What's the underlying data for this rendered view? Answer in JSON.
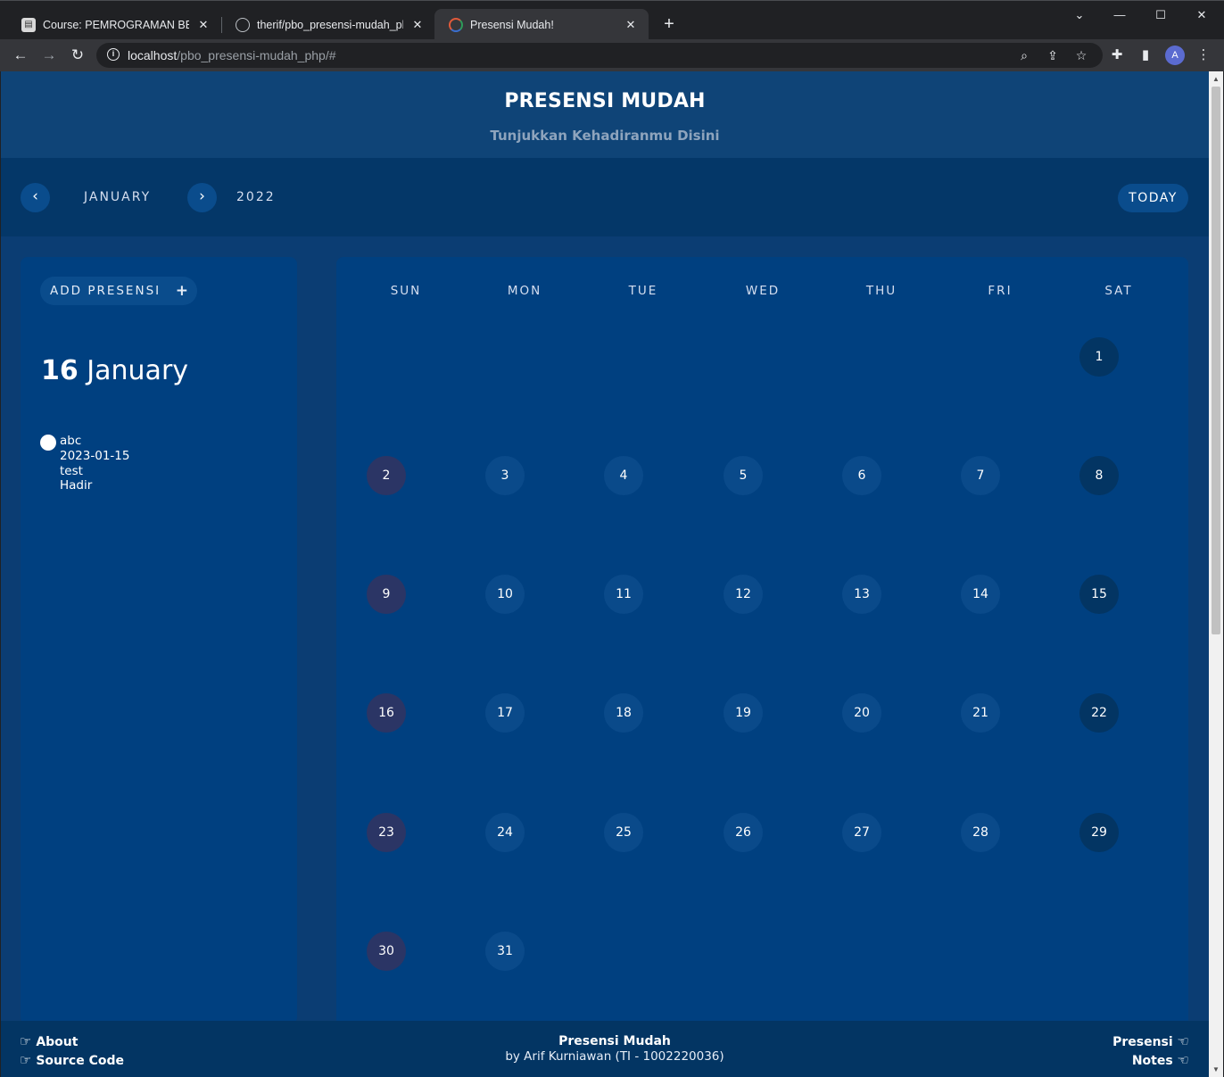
{
  "browser": {
    "tabs": [
      {
        "label": "Course: PEMROGRAMAN BERORI",
        "icon": "moodle-icon",
        "active": false
      },
      {
        "label": "therif/pbo_presensi-mudah_php:",
        "icon": "github-icon",
        "active": false
      },
      {
        "label": "Presensi Mudah!",
        "icon": "spinner-icon",
        "active": true
      }
    ],
    "url_host": "localhost",
    "url_path": "/pbo_presensi-mudah_php/#",
    "profile_initial": "A"
  },
  "header": {
    "title": "PRESENSI MUDAH",
    "subtitle": "Tunjukkan Kehadiranmu Disini"
  },
  "calendar_nav": {
    "prev_label": "‹",
    "next_label": "›",
    "month": "JANUARY",
    "year": "2022",
    "today_label": "TODAY"
  },
  "sidebar": {
    "add_label": "ADD PRESENSI",
    "add_icon": "+",
    "selected_day": "16",
    "selected_month": "January",
    "event": {
      "name": "abc",
      "date": "2023-01-15",
      "note": "test",
      "status": "Hadir"
    }
  },
  "calendar": {
    "weekdays": [
      "SUN",
      "MON",
      "TUE",
      "WED",
      "THU",
      "FRI",
      "SAT"
    ],
    "first_weekday_index": 6,
    "days_in_month": 31
  },
  "footer": {
    "about": "About",
    "source_code": "Source Code",
    "app_name": "Presensi Mudah",
    "credit": "by Arif Kurniawan (TI - 1002220036)",
    "presensi": "Presensi",
    "notes": "Notes"
  }
}
